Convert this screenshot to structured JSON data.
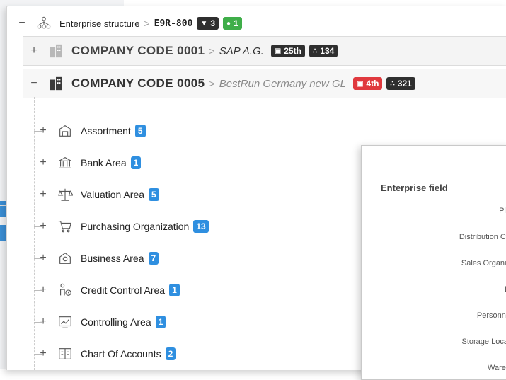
{
  "structure": {
    "title": "Enterprise structure",
    "code": "E9R-800",
    "filter_count": "3",
    "status_count": "1",
    "toggle": "−"
  },
  "companies": [
    {
      "toggle": "+",
      "label": "COMPANY CODE 0001",
      "desc": "SAP A.G.",
      "rank": "25th",
      "count": "134"
    },
    {
      "toggle": "−",
      "label": "COMPANY CODE 0005",
      "desc": "BestRun Germany new GL",
      "rank": "4th",
      "count": "321"
    }
  ],
  "items": [
    {
      "label": "Assortment",
      "count": "5",
      "icon": "assortment-icon"
    },
    {
      "label": "Bank Area",
      "count": "1",
      "icon": "bank-icon"
    },
    {
      "label": "Valuation Area",
      "count": "5",
      "icon": "scale-icon"
    },
    {
      "label": "Purchasing Organization",
      "count": "13",
      "icon": "cart-icon"
    },
    {
      "label": "Business Area",
      "count": "7",
      "icon": "building-icon"
    },
    {
      "label": "Credit Control Area",
      "count": "1",
      "icon": "credit-control-icon"
    },
    {
      "label": "Controlling Area",
      "count": "1",
      "icon": "controlling-icon"
    },
    {
      "label": "Chart Of Accounts",
      "count": "2",
      "icon": "ledger-icon"
    }
  ],
  "popup": {
    "title": "Enterprise field",
    "fields": [
      "Pla",
      "Distribution Ch",
      "Sales Organiz",
      "D",
      "Personne",
      "Storage Locat",
      "Wareh"
    ]
  },
  "colors": {
    "badge_blue": "#2f8fe0",
    "badge_red": "#e0393e",
    "badge_green": "#3fae49",
    "badge_dark": "#2f2f2f"
  }
}
